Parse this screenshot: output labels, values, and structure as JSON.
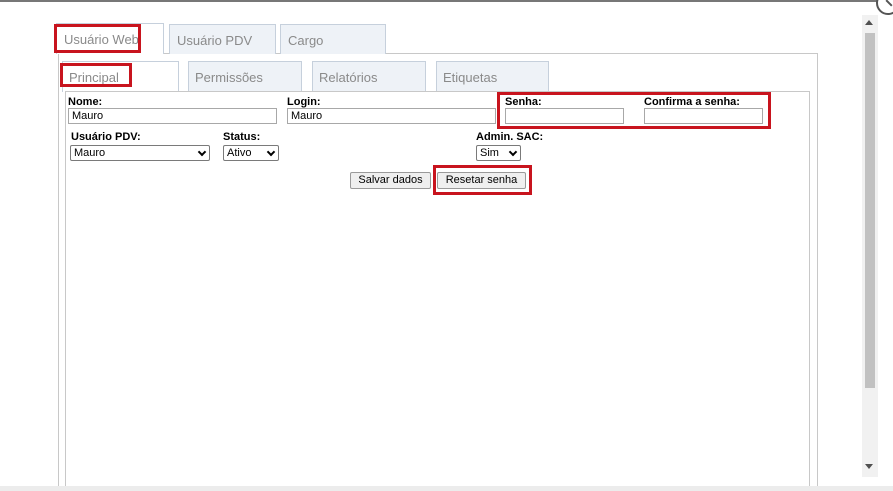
{
  "tabs": [
    {
      "label": "Usuário Web",
      "active": true
    },
    {
      "label": "Usuário PDV",
      "active": false
    },
    {
      "label": "Cargo",
      "active": false
    }
  ],
  "subtabs": [
    {
      "label": "Principal",
      "active": true
    },
    {
      "label": "Permissões",
      "active": false
    },
    {
      "label": "Relatórios",
      "active": false
    },
    {
      "label": "Etiquetas",
      "active": false
    }
  ],
  "form": {
    "nome": {
      "label": "Nome:",
      "value": "Mauro"
    },
    "login": {
      "label": "Login:",
      "value": "Mauro"
    },
    "senha": {
      "label": "Senha:",
      "value": ""
    },
    "confirma": {
      "label": "Confirma a senha:",
      "value": ""
    },
    "usuario_pdv": {
      "label": "Usuário PDV:",
      "selected": "Mauro"
    },
    "status": {
      "label": "Status:",
      "selected": "Ativo"
    },
    "admin_sac": {
      "label": "Admin. SAC:",
      "selected": "Sim"
    }
  },
  "buttons": {
    "save": "Salvar dados",
    "reset": "Resetar senha"
  },
  "colors": {
    "highlight": "#c8141e",
    "tab_bg": "#eef2f7",
    "tab_border": "#c6d0dc"
  }
}
